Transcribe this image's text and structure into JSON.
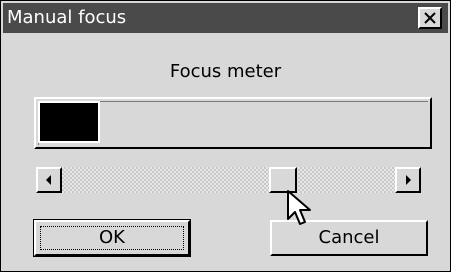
{
  "window": {
    "title": "Manual focus",
    "close_icon": "close-icon"
  },
  "meter": {
    "label": "Focus meter",
    "level": 0.15
  },
  "slider": {
    "position": 0.68,
    "left_arrow_icon": "arrow-left-icon",
    "right_arrow_icon": "arrow-right-icon"
  },
  "buttons": {
    "ok_label": "OK",
    "cancel_label": "Cancel"
  },
  "colors": {
    "window_bg": "#d8d8d8",
    "titlebar_bg": "#4a4a4a",
    "meter_fill": "#000000"
  }
}
